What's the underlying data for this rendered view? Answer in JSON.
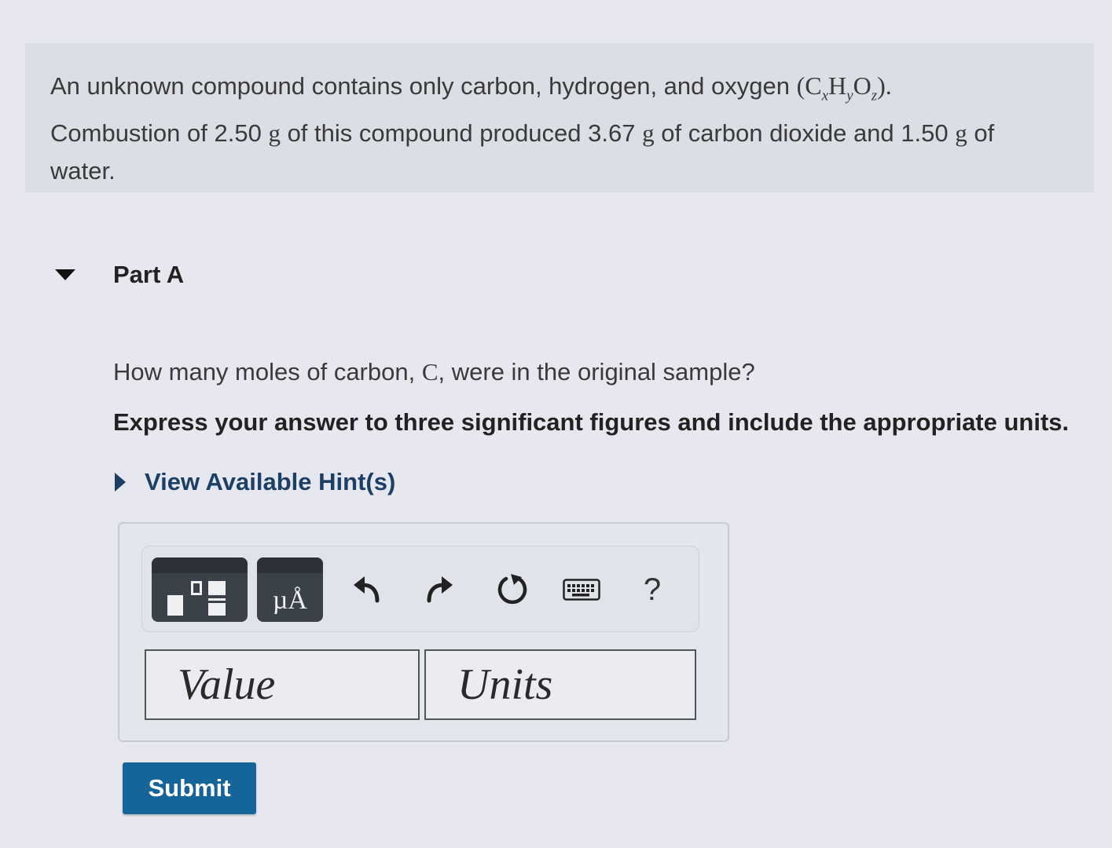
{
  "intro": {
    "text_before_formula": "An unknown compound contains only carbon, hydrogen, and oxygen ",
    "formula": {
      "open": "(",
      "c": "C",
      "c_sub": "x",
      "h": "H",
      "h_sub": "y",
      "o": "O",
      "o_sub": "z",
      "close": ")."
    },
    "line2_pre": "Combustion of 2.50 ",
    "unit_g": "g",
    "line2_mid": " of this compound produced 3.67 ",
    "line2_mid2": " of carbon dioxide and 1.50 ",
    "line2_end": " of",
    "line3": "water."
  },
  "part": {
    "title": "Part A"
  },
  "question": {
    "pre": "How many moles of carbon, ",
    "symbol": "C",
    "post": ", were in the original sample?"
  },
  "instruction": "Express your answer to three significant figures and include the appropriate units.",
  "hint_link": "View Available Hint(s)",
  "toolbar": {
    "units_symbol": "µÅ",
    "help": "?",
    "icons": [
      "templates-icon",
      "units-icon",
      "undo-icon",
      "redo-icon",
      "reset-icon",
      "keyboard-icon",
      "help-icon"
    ]
  },
  "answer": {
    "value_placeholder": "Value",
    "units_placeholder": "Units"
  },
  "submit_label": "Submit",
  "colors": {
    "accent": "#15649a",
    "link": "#1c3f66",
    "background": "#e7e8ef"
  }
}
